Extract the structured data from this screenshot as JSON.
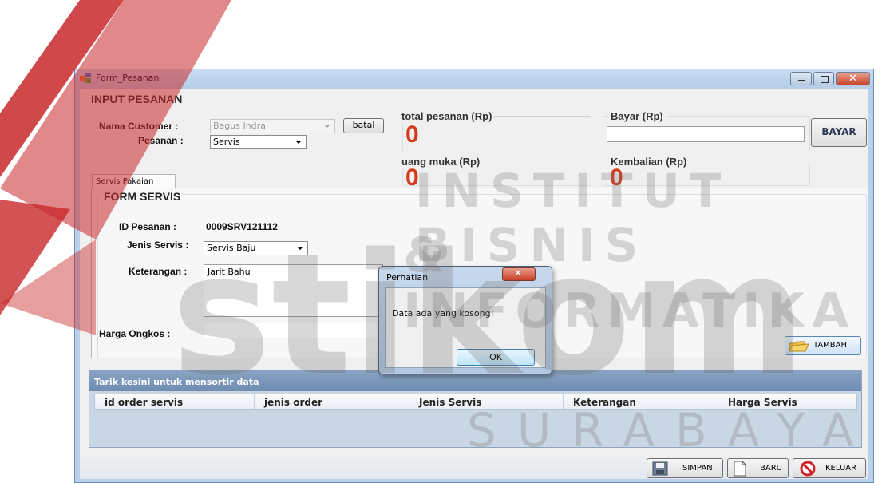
{
  "window": {
    "title": "Form_Pesanan"
  },
  "header": {
    "title": "INPUT PESANAN"
  },
  "customer": {
    "label": "Nama Customer  :",
    "value": "Bagus Indra",
    "batal_label": "batal"
  },
  "pesanan": {
    "label": "Pesanan  :",
    "value": "Servis"
  },
  "totals": {
    "total_title": "total pesanan (Rp)",
    "total_value": "0",
    "uang_muka_title": "uang muka (Rp)",
    "uang_muka_value": "0",
    "bayar_title": "Bayar (Rp)",
    "bayar_value": "",
    "kembalian_title": "Kembalian (Rp)",
    "kembalian_value": "0",
    "bayar_button": "BAYAR"
  },
  "tab": {
    "label": "Servis Pakaian"
  },
  "form_servis": {
    "title": "FORM SERVIS",
    "id_label": "ID Pesanan  :",
    "id_value": "0009SRV121112",
    "jenis_label": "Jenis Servis :",
    "jenis_value": "Servis Baju",
    "keterangan_label": "Keterangan  :",
    "keterangan_value": "Jarit Bahu",
    "harga_label": "Harga Ongkos  :",
    "harga_value": "",
    "tambah_label": "TAMBAH"
  },
  "grid": {
    "group_text": "Tarik kesini untuk mensortir data",
    "columns": [
      "id order servis",
      "jenis order",
      "Jenis Servis",
      "Keterangan",
      "Harga Servis"
    ]
  },
  "footer": {
    "simpan": "SIMPAN",
    "baru": "BARU",
    "keluar": "KELUAR"
  },
  "dialog": {
    "title": "Perhatian",
    "message": "Data ada yang kosong!",
    "ok": "OK"
  },
  "watermark": {
    "line1": "INSTITUT BISNIS",
    "line2": "& INFORMATIKA",
    "line3": "stikom",
    "line4": "SURABAYA"
  },
  "colors": {
    "accent_number": "#d43b1a",
    "watermark_red": "#c8282a"
  }
}
